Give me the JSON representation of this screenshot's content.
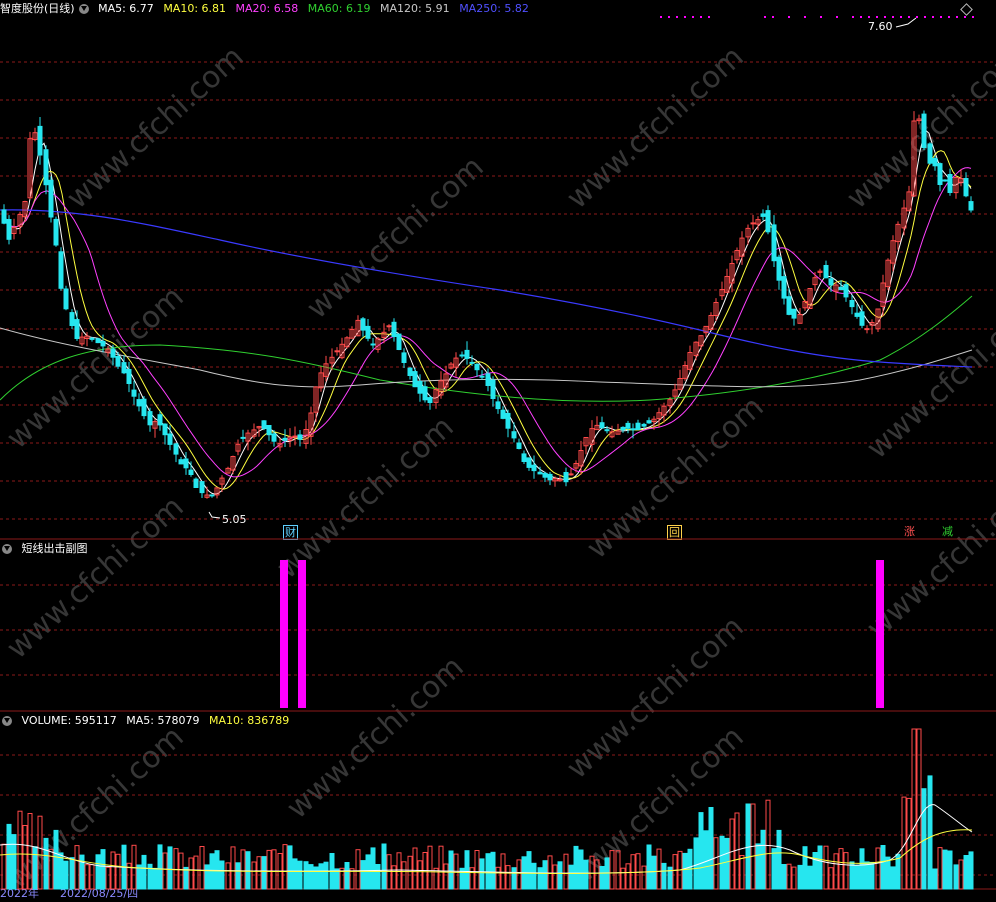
{
  "main_legend": {
    "stock": "智度股份(日线)",
    "ma5": "MA5: 6.77",
    "ma10": "MA10: 6.81",
    "ma20": "MA20: 6.58",
    "ma60": "MA60: 6.19",
    "ma120": "MA120: 5.91",
    "ma250": "MA250: 5.82"
  },
  "price_high_label": "7.60",
  "price_low_label": "5.05",
  "events": [
    "财",
    "回",
    "涨",
    "减"
  ],
  "sub_panel_title": "短线出击副图",
  "volume_legend": {
    "volume": "VOLUME: 595117",
    "ma5": "MA5: 578079",
    "ma10": "MA10: 836789"
  },
  "bottom_dates": {
    "year": "2022年",
    "date": "2022/08/25/四"
  },
  "watermark": "www.cfchi.com",
  "colors": {
    "up": "#ff4a4a",
    "down": "#26e6ef",
    "ma5": "#ffffff",
    "ma10": "#ffff40",
    "ma20": "#ff40ff",
    "ma60": "#30d030",
    "ma120": "#c8c8c8",
    "ma250": "#3a3aff",
    "signal": "#ff00ff",
    "grid": "#8b1a1a"
  }
}
